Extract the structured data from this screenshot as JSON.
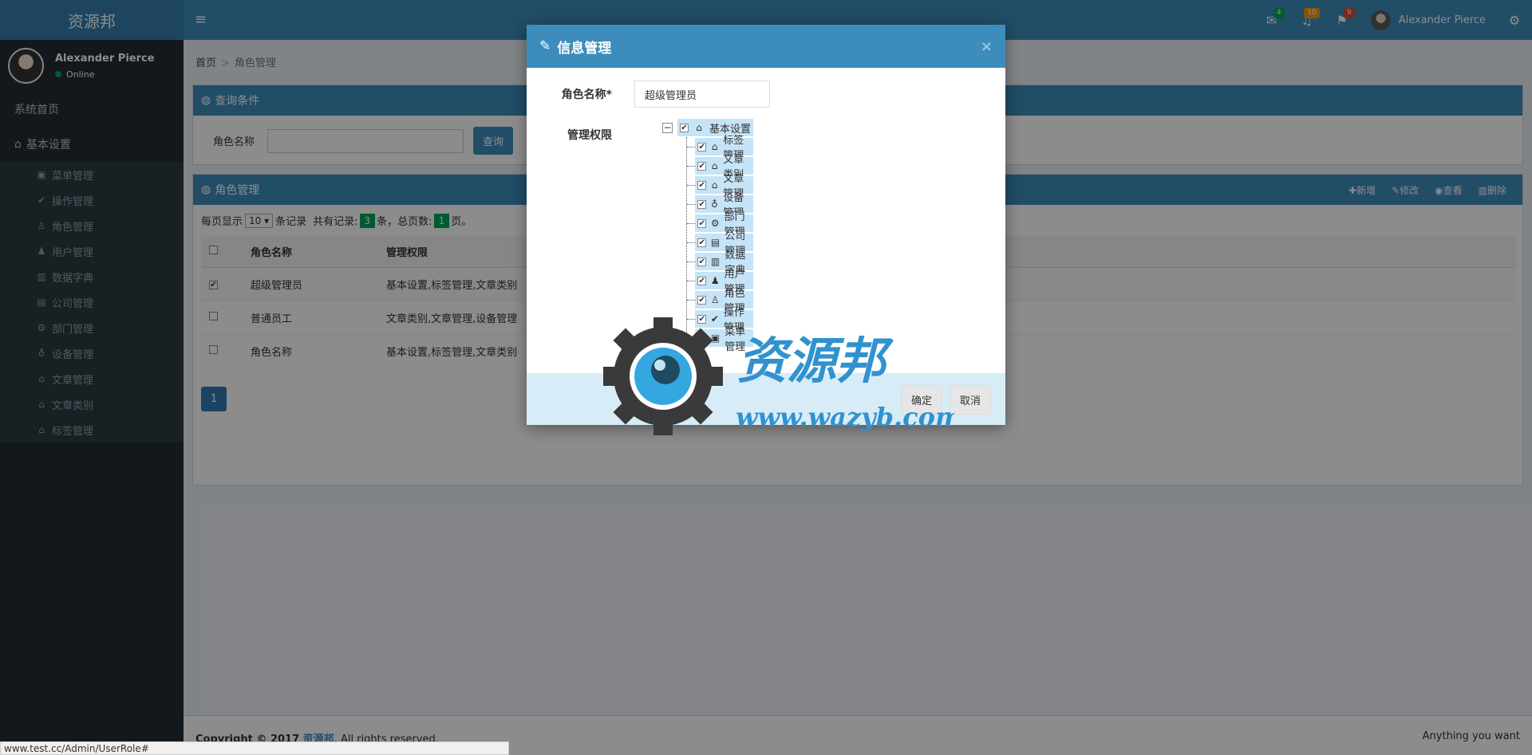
{
  "header": {
    "logo": "资源邦",
    "toggle_icon": "menu-icon",
    "mail_count": "4",
    "bell_count": "10",
    "flag_count": "9",
    "user_name": "Alexander Pierce",
    "colors": {
      "header": "#3c8dbc",
      "logo_bg": "#367fa9",
      "mail_badge": "#00a65a",
      "bell_badge": "#f39c12",
      "flag_badge": "#dd4b39"
    }
  },
  "sidebar": {
    "user_name": "Alexander Pierce",
    "status": "Online",
    "home": "系统首页",
    "section": "基本设置",
    "items": [
      {
        "label": "菜单管理",
        "icon": "card-icon",
        "glyph": "▣"
      },
      {
        "label": "操作管理",
        "icon": "check-circle-icon",
        "glyph": "✔"
      },
      {
        "label": "角色管理",
        "icon": "user-shield-icon",
        "glyph": "♙"
      },
      {
        "label": "用户管理",
        "icon": "user-plus-icon",
        "glyph": "♟"
      },
      {
        "label": "数据字典",
        "icon": "bar-chart-icon",
        "glyph": "▥"
      },
      {
        "label": "公司管理",
        "icon": "briefcase-icon",
        "glyph": "▤"
      },
      {
        "label": "部门管理",
        "icon": "gear-icon",
        "glyph": "⚙"
      },
      {
        "label": "设备管理",
        "icon": "lightbulb-icon",
        "glyph": "♁"
      },
      {
        "label": "文章管理",
        "icon": "home-icon",
        "glyph": "⌂"
      },
      {
        "label": "文章类别",
        "icon": "home-icon",
        "glyph": "⌂"
      },
      {
        "label": "标签管理",
        "icon": "home-icon",
        "glyph": "⌂"
      }
    ]
  },
  "breadcrumb": {
    "home": "首页",
    "sep": ">",
    "current": "角色管理"
  },
  "query_box": {
    "title": "查询条件",
    "label": "角色名称",
    "button": "查询"
  },
  "list_box": {
    "title": "角色管理",
    "tools": [
      "✚新增",
      "✎修改",
      "◉查看",
      "▥删除"
    ],
    "page_size_prefix": "每页显示",
    "page_size": "10 ▾",
    "page_size_suffix": "条记录",
    "total_prefix": "共有记录:",
    "total": "3",
    "total_suffix": "条，总页数:",
    "pages": "1",
    "pages_suffix": "页。",
    "columns": [
      "",
      "角色名称",
      "管理权限"
    ],
    "rows": [
      {
        "checked": "✔",
        "name": "超级管理员",
        "perms": "基本设置,标签管理,文章类别"
      },
      {
        "checked": "",
        "name": "普通员工",
        "perms": "文章类别,文章管理,设备管理"
      },
      {
        "checked": "",
        "name": "角色名称",
        "perms": "基本设置,标签管理,文章类别"
      }
    ],
    "page_button": "1"
  },
  "footer": {
    "copyright": "Copyright © 2017",
    "brand": "资源邦",
    "rights": ". All rights reserved.",
    "right_text": "Anything you want"
  },
  "status_url": "www.test.cc/Admin/UserRole#",
  "modal": {
    "title": "信息管理",
    "close": "×",
    "role_label": "角色名称*",
    "role_value": "超级管理员",
    "perm_label": "管理权限",
    "tree_root": {
      "label": "基本设置",
      "glyph": "⌂",
      "toggle": "−"
    },
    "tree_children": [
      {
        "label": "标签管理",
        "glyph": "⌂",
        "icon": "home-icon"
      },
      {
        "label": "文章类别",
        "glyph": "⌂",
        "icon": "home-icon"
      },
      {
        "label": "文章管理",
        "glyph": "⌂",
        "icon": "home-icon"
      },
      {
        "label": "设备管理",
        "glyph": "♁",
        "icon": "lightbulb-icon"
      },
      {
        "label": "部门管理",
        "glyph": "⚙",
        "icon": "gear-icon"
      },
      {
        "label": "公司管理",
        "glyph": "▤",
        "icon": "briefcase-icon"
      },
      {
        "label": "数据字典",
        "glyph": "▥",
        "icon": "bar-chart-icon"
      },
      {
        "label": "用户管理",
        "glyph": "♟",
        "icon": "user-plus-icon"
      },
      {
        "label": "角色管理",
        "glyph": "♙",
        "icon": "user-shield-icon"
      },
      {
        "label": "操作管理",
        "glyph": "✔",
        "icon": "check-circle-icon"
      },
      {
        "label": "菜单管理",
        "glyph": "▣",
        "icon": "card-icon"
      }
    ],
    "ok": "确定",
    "cancel": "取消"
  },
  "watermark": {
    "text": "资源邦",
    "url": "www.wazyb.com"
  }
}
